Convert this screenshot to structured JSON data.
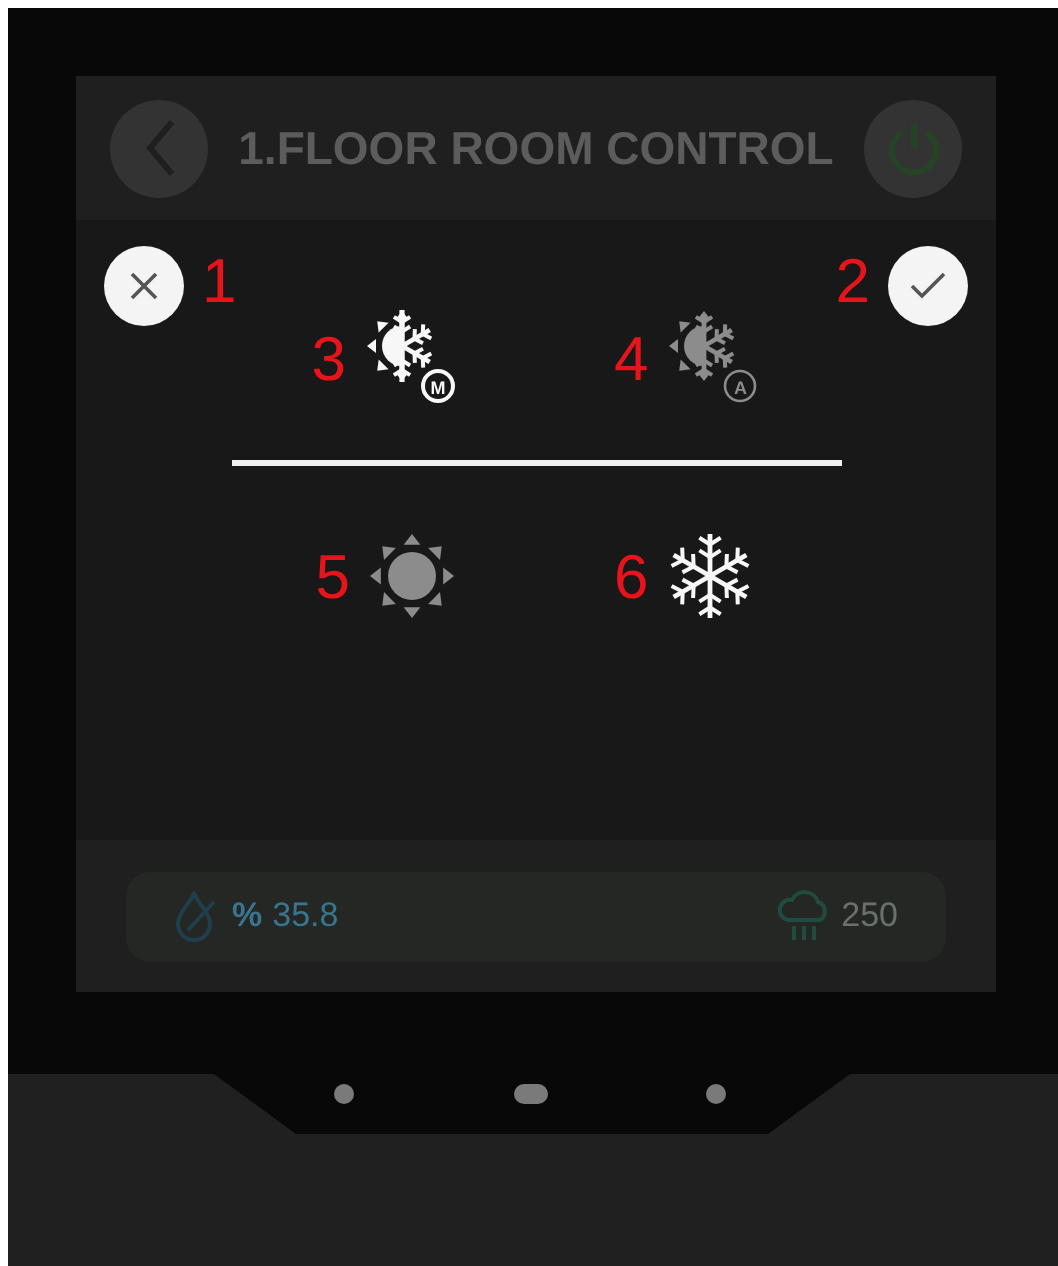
{
  "header": {
    "title": "1.FLOOR ROOM CONTROL"
  },
  "dialog": {
    "cancel_marker": "1",
    "confirm_marker": "2",
    "changeover_modes": [
      {
        "kind": "manual",
        "badge": "M",
        "marker": "3",
        "selected": true
      },
      {
        "kind": "auto",
        "badge": "A",
        "marker": "4",
        "selected": false
      }
    ],
    "hvac_modes": [
      {
        "kind": "heat",
        "marker": "5",
        "selected": false
      },
      {
        "kind": "cool",
        "marker": "6",
        "selected": true
      }
    ]
  },
  "readings": [
    {
      "kind": "humidity",
      "unit": "%",
      "value": "35.8"
    },
    {
      "kind": "co2",
      "value": "250"
    }
  ]
}
